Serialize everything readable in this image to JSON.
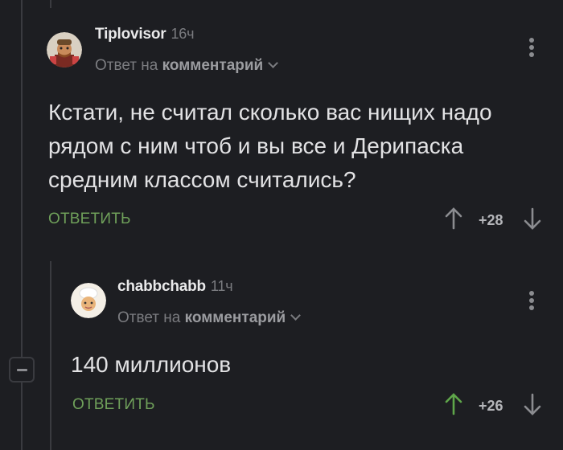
{
  "comments": [
    {
      "author": "Tiplovisor",
      "time": "16ч",
      "reply_prefix": "Ответ на",
      "reply_target": "комментарий",
      "text": "Кстати, не считал сколько вас нищих надо рядом с ним чтоб и вы все и Дерипаска средним классом считались?",
      "reply_label": "ОТВЕТИТЬ",
      "score": "+28"
    },
    {
      "author": "chabbchabb",
      "time": "11ч",
      "reply_prefix": "Ответ на",
      "reply_target": "комментарий",
      "text": "140 миллионов",
      "reply_label": "ОТВЕТИТЬ",
      "score": "+26"
    }
  ],
  "colors": {
    "background": "#1d1e22",
    "accent_green": "#6fa05a",
    "upvoted_green": "#5fa64a",
    "muted": "#7b7c80"
  },
  "icons": [
    "more-vertical-icon",
    "arrow-up-icon",
    "arrow-down-icon",
    "chevron-down-icon",
    "collapse-icon"
  ]
}
